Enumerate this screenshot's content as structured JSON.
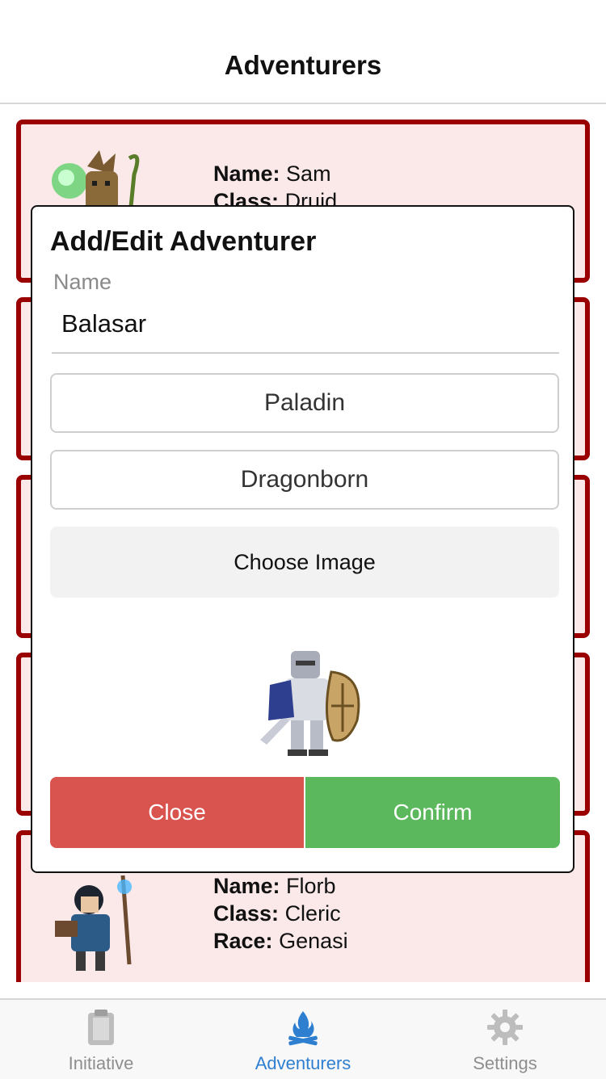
{
  "header": {
    "title": "Adventurers"
  },
  "cards": [
    {
      "name_label": "Name:",
      "name": "Sam",
      "class_label": "Class:",
      "class": "Druid"
    },
    {
      "name_label": "Name:",
      "name": "Florb",
      "class_label": "Class:",
      "class": "Cleric",
      "race_label": "Race:",
      "race": "Genasi"
    }
  ],
  "modal": {
    "title": "Add/Edit Adventurer",
    "name_label": "Name",
    "name_value": "Balasar",
    "class_value": "Paladin",
    "race_value": "Dragonborn",
    "choose_image_label": "Choose Image",
    "close_label": "Close",
    "confirm_label": "Confirm"
  },
  "tabs": [
    {
      "label": "Initiative",
      "icon": "clipboard-icon",
      "active": false
    },
    {
      "label": "Adventurers",
      "icon": "campfire-icon",
      "active": true
    },
    {
      "label": "Settings",
      "icon": "gear-icon",
      "active": false
    }
  ],
  "colors": {
    "card_border": "#9b0000",
    "card_bg": "#fbe9e9",
    "close": "#d9534f",
    "confirm": "#5cb85c",
    "active_tab": "#2f7fd1"
  }
}
